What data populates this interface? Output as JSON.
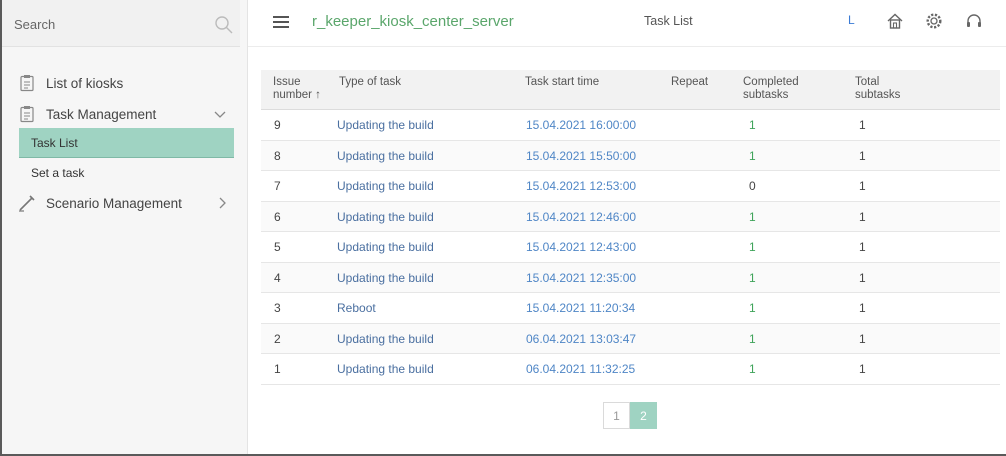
{
  "sidebar": {
    "search_placeholder": "Search",
    "items": [
      {
        "label": "List of kiosks"
      },
      {
        "label": "Task Management"
      },
      {
        "label": "Scenario Management"
      }
    ],
    "sub_items": [
      {
        "label": "Task List"
      },
      {
        "label": "Set a task"
      }
    ]
  },
  "header": {
    "app_title": "r_keeper_kiosk_center_server",
    "page_title": "Task List",
    "user_initial": "L"
  },
  "table": {
    "columns": {
      "issue_number": "Issue\nnumber ↑",
      "type": "Type of task",
      "start_time": "Task start time",
      "repeat": "Repeat",
      "completed": "Completed\nsubtasks",
      "total": "Total\nsubtasks"
    },
    "rows": [
      {
        "num": "9",
        "type": "Updating the build",
        "time": "15.04.2021 16:00:00",
        "completed": "1",
        "total": "1"
      },
      {
        "num": "8",
        "type": "Updating the build",
        "time": "15.04.2021 15:50:00",
        "completed": "1",
        "total": "1"
      },
      {
        "num": "7",
        "type": "Updating the build",
        "time": "15.04.2021 12:53:00",
        "completed": "0",
        "total": "1"
      },
      {
        "num": "6",
        "type": "Updating the build",
        "time": "15.04.2021 12:46:00",
        "completed": "1",
        "total": "1"
      },
      {
        "num": "5",
        "type": "Updating the build",
        "time": "15.04.2021 12:43:00",
        "completed": "1",
        "total": "1"
      },
      {
        "num": "4",
        "type": "Updating the build",
        "time": "15.04.2021 12:35:00",
        "completed": "1",
        "total": "1"
      },
      {
        "num": "3",
        "type": "Reboot",
        "time": "15.04.2021 11:20:34",
        "completed": "1",
        "total": "1"
      },
      {
        "num": "2",
        "type": "Updating the build",
        "time": "06.04.2021 13:03:47",
        "completed": "1",
        "total": "1"
      },
      {
        "num": "1",
        "type": "Updating the build",
        "time": "06.04.2021 11:32:25",
        "completed": "1",
        "total": "1"
      }
    ]
  },
  "pagination": {
    "pages": [
      "1",
      "2"
    ],
    "current": "2"
  },
  "colors": {
    "accent": "#9fd3c2",
    "title_green": "#5aa66b",
    "link_blue": "#4f86c6"
  }
}
